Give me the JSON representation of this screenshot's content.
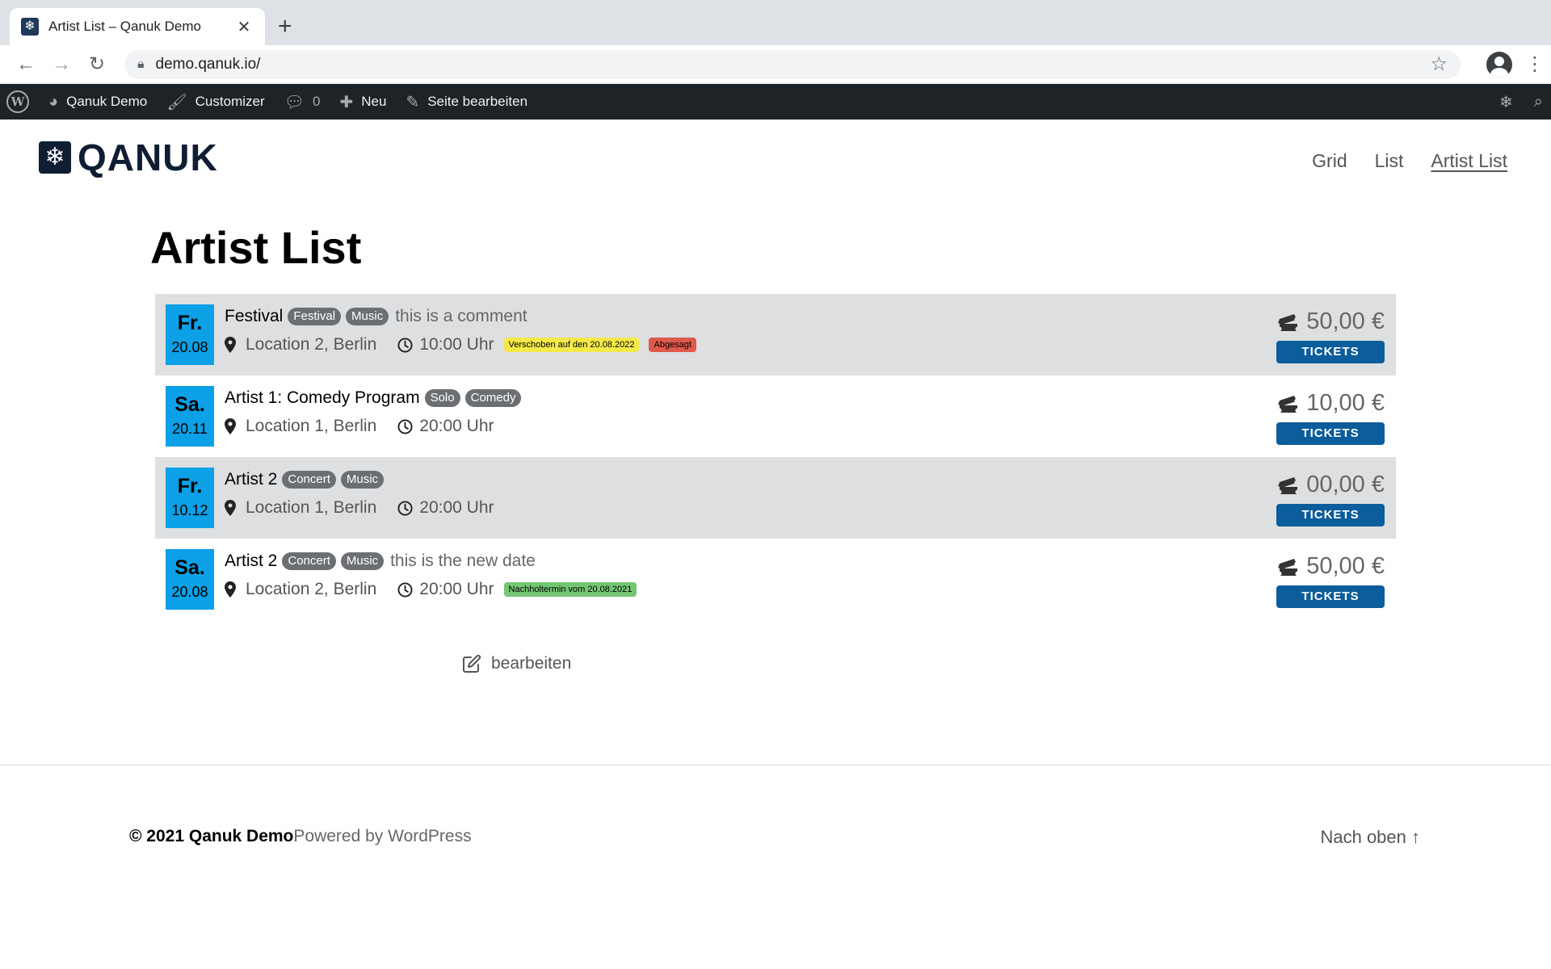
{
  "browser": {
    "tab_title": "Artist List – Qanuk Demo",
    "url": "demo.qanuk.io/"
  },
  "adminbar": {
    "site_name": "Qanuk Demo",
    "customizer": "Customizer",
    "comments_count": "0",
    "new_label": "Neu",
    "edit_page": "Seite bearbeiten"
  },
  "header": {
    "logo_text": "QANUK",
    "nav": [
      "Grid",
      "List",
      "Artist List"
    ],
    "current_nav": "Artist List"
  },
  "page": {
    "title": "Artist List",
    "edit_label": "bearbeiten"
  },
  "events": [
    {
      "dow": "Fr.",
      "date": "20.08",
      "title": "Festival",
      "tags": [
        "Festival",
        "Music"
      ],
      "comment": "this is a comment",
      "location": "Location 2, Berlin",
      "time": "10:00 Uhr",
      "notices": [
        {
          "text": "Verschoben auf den 20.08.2022",
          "color": "#f5e94a"
        },
        {
          "text": "Abgesagt",
          "color": "#e0594d"
        }
      ],
      "price": "50,00 €",
      "button": "TICKETS"
    },
    {
      "dow": "Sa.",
      "date": "20.11",
      "title": "Artist 1: Comedy Program",
      "tags": [
        "Solo",
        "Comedy"
      ],
      "comment": "",
      "location": "Location 1, Berlin",
      "time": "20:00 Uhr",
      "notices": [],
      "price": "10,00 €",
      "button": "TICKETS"
    },
    {
      "dow": "Fr.",
      "date": "10.12",
      "title": "Artist 2",
      "tags": [
        "Concert",
        "Music"
      ],
      "comment": "",
      "location": "Location 1, Berlin",
      "time": "20:00 Uhr",
      "notices": [],
      "price": "00,00 €",
      "button": "TICKETS"
    },
    {
      "dow": "Sa.",
      "date": "20.08",
      "title": "Artist 2",
      "tags": [
        "Concert",
        "Music"
      ],
      "comment": "this is the new date",
      "location": "Location 2, Berlin",
      "time": "20:00 Uhr",
      "notices": [
        {
          "text": "Nachholtermin vom 20.08.2021",
          "color": "#73c672"
        }
      ],
      "price": "50,00 €",
      "button": "TICKETS"
    }
  ],
  "footer": {
    "copyright": "© 2021 Qanuk Demo",
    "powered": "Powered by WordPress",
    "to_top": "Nach oben ↑"
  },
  "colors": {
    "date_badge": "#0ca0e6",
    "ticket_button": "#0c5d9b",
    "row_shade": "#dddfe1",
    "tag": "#6b6e72"
  }
}
